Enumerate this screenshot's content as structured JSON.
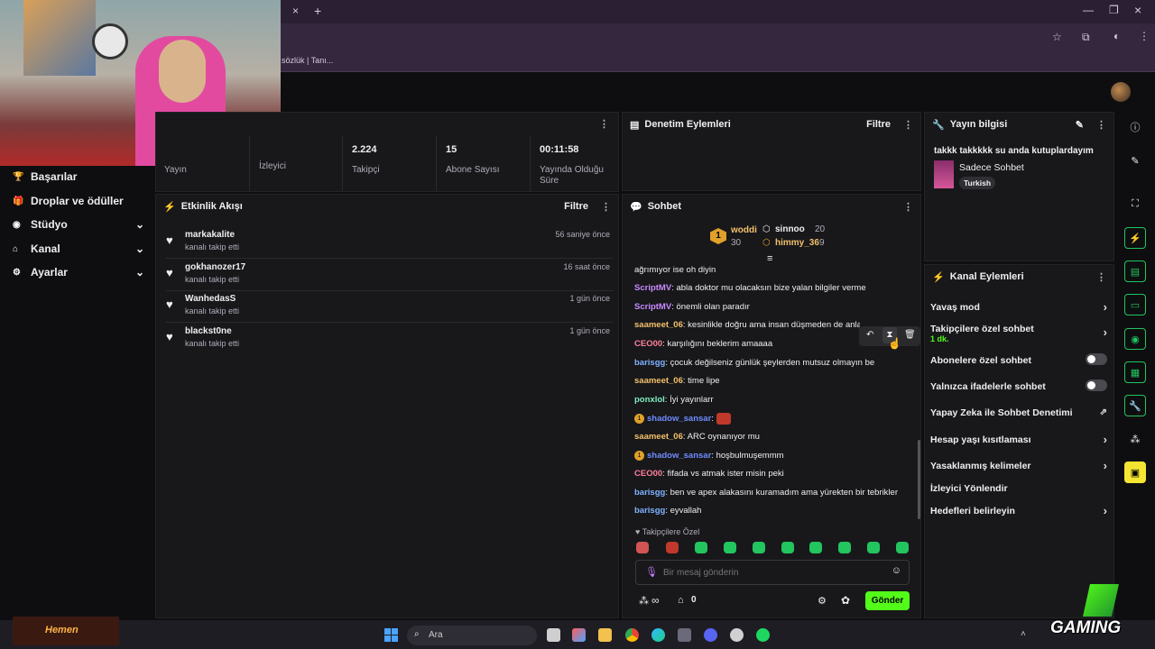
{
  "browser": {
    "tab_close": "×",
    "tab_add": "+",
    "bookmark_text": "sözlük | Tanı..."
  },
  "sidebar": {
    "items": [
      {
        "label": "Başarılar",
        "icon": "trophy-icon",
        "has_chevron": false
      },
      {
        "label": "Droplar ve ödüller",
        "icon": "gift-icon",
        "has_chevron": false
      },
      {
        "label": "Stüdyo",
        "icon": "studio-icon",
        "has_chevron": true
      },
      {
        "label": "Kanal",
        "icon": "channel-icon",
        "has_chevron": true
      },
      {
        "label": "Ayarlar",
        "icon": "gear-icon",
        "has_chevron": true
      }
    ]
  },
  "stats": {
    "items": [
      {
        "value": "",
        "label": "Yayın"
      },
      {
        "value": "",
        "label": "İzleyici"
      },
      {
        "value": "2.224",
        "label": "Takipçi"
      },
      {
        "value": "15",
        "label": "Abone Sayısı"
      },
      {
        "value": "00:11:58",
        "label": "Yayında Olduğu Süre"
      }
    ]
  },
  "activity": {
    "title": "Etkinlik Akışı",
    "filter": "Filtre",
    "items": [
      {
        "name": "markakalite",
        "sub": "kanalı takip etti",
        "time": "56 saniye önce"
      },
      {
        "name": "gokhanozer17",
        "sub": "kanalı takip etti",
        "time": "16 saat önce"
      },
      {
        "name": "WanhedasS",
        "sub": "kanalı takip etti",
        "time": "1 gün önce"
      },
      {
        "name": "blackst0ne",
        "sub": "kanalı takip etti",
        "time": "1 gün önce"
      }
    ]
  },
  "moderation": {
    "title": "Denetim Eylemleri",
    "filter": "Filtre"
  },
  "chat": {
    "title": "Sohbet",
    "leaderboard": [
      {
        "rank": "1",
        "name": "woddi",
        "count": "30"
      },
      {
        "name": "sinnoo",
        "count": "20"
      },
      {
        "name": "himmy_36",
        "count": "9"
      }
    ],
    "messages": [
      {
        "user": "",
        "color": "#efeff1",
        "text": "ağrımıyor ise oh diyin"
      },
      {
        "user": "ScriptMV",
        "color": "#c98bff",
        "text": "abla doktor mu olacaksın bize yalan bilgiler verme"
      },
      {
        "user": "ScriptMV",
        "color": "#c98bff",
        "text": "önemli olan paradır"
      },
      {
        "user": "saameet_06",
        "color": "#f3c06a",
        "text": "kesinlikle doğru ama insan düşmeden de anlamıyor"
      },
      {
        "user": "CEO00",
        "color": "#ff7f9a",
        "text": "karşılığını beklerim amaaaa"
      },
      {
        "user": "barisgg",
        "color": "#7fb2ff",
        "text": "çocuk değilseniz günlük şeylerden mutsuz olmayın be"
      },
      {
        "user": "saameet_06",
        "color": "#f3c06a",
        "text": "time lipe"
      },
      {
        "user": "ponxlol",
        "color": "#7ff0c0",
        "text": "İyi yayınlarr"
      },
      {
        "user": "shadow_sansar",
        "color": "#6f8cff",
        "text": "",
        "badge": "1"
      },
      {
        "user": "saameet_06",
        "color": "#f3c06a",
        "text": "ARC oynanıyor mu"
      },
      {
        "user": "shadow_sansar",
        "color": "#6f8cff",
        "text": "hoşbulmuşemmm",
        "badge": "1"
      },
      {
        "user": "CEO00",
        "color": "#ff7f9a",
        "text": "fifada vs atmak ister misin peki"
      },
      {
        "user": "barisgg",
        "color": "#7fb2ff",
        "text": "ben ve apex alakasını kuramadım ama yürekten bir tebrikler"
      },
      {
        "user": "barisgg",
        "color": "#7fb2ff",
        "text": "eyvallah"
      }
    ],
    "emote_header": "Takipçilere Özel",
    "input_placeholder": "Bir mesaj gönderin",
    "points": "∞",
    "count": "0",
    "send": "Gönder"
  },
  "stream_info": {
    "title": "Yayın bilgisi",
    "stream_title": "takkk takkkkk su anda kutuplardayım",
    "category": "Sadece Sohbet",
    "tag": "Turkish"
  },
  "channel_actions": {
    "title": "Kanal Eylemleri",
    "rows": [
      {
        "label": "Yavaş mod",
        "type": "chevron"
      },
      {
        "label": "Takipçilere özel sohbet",
        "sub": "1 dk.",
        "type": "chevron"
      },
      {
        "label": "Abonelere özel sohbet",
        "type": "toggle"
      },
      {
        "label": "Yalnızca ifadelerle sohbet",
        "type": "toggle"
      },
      {
        "label": "Yapay Zeka ile Sohbet Denetimi",
        "type": "external"
      },
      {
        "label": "Hesap yaşı kısıtlaması",
        "type": "chevron"
      },
      {
        "label": "Yasaklanmış kelimeler",
        "type": "chevron"
      },
      {
        "label": "İzleyici Yönlendir",
        "type": "none"
      },
      {
        "label": "Hedefleri belirleyin",
        "type": "chevron"
      }
    ]
  },
  "taskbar": {
    "search": "Ara",
    "promo": "Hemen"
  },
  "overlay": {
    "watermark": "GAMING"
  },
  "colors": {
    "accent": "#53fc18",
    "bg": "#0e0e10",
    "panel": "#18181b"
  }
}
